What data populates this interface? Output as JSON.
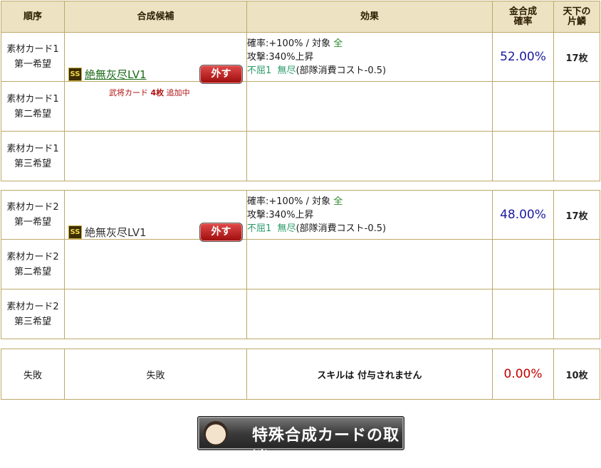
{
  "header": {
    "order": "順序",
    "candidate": "合成候補",
    "effect": "効果",
    "rate_line1": "金合成",
    "rate_line2": "確率",
    "scale_line1": "天下の",
    "scale_line2": "片鱗"
  },
  "groups": [
    {
      "rows": [
        {
          "label_line1": "素材カード1",
          "label_line2": "第一希望",
          "badge": "SS",
          "skill": "絶無灰尽LV1",
          "remove": "外す",
          "note_prefix": "武将カード ",
          "note_count": "4枚",
          "note_suffix": " 追加中",
          "effect_rate": "確率:+100%  /  対象",
          "effect_target": "全",
          "effect_attack": "攻撃:340%上昇",
          "effect_immortal": "不屈1",
          "effect_infinite": "無尽",
          "effect_cost": "(部隊消費コスト-0.5)",
          "probability": "52.00%",
          "count": "17枚"
        },
        {
          "label_line1": "素材カード1",
          "label_line2": "第二希望"
        },
        {
          "label_line1": "素材カード1",
          "label_line2": "第三希望"
        }
      ]
    },
    {
      "rows": [
        {
          "label_line1": "素材カード2",
          "label_line2": "第一希望",
          "badge": "SS",
          "skill": "絶無灰尽LV1",
          "remove": "外す",
          "effect_rate": "確率:+100%  /  対象",
          "effect_target": "全",
          "effect_attack": "攻撃:340%上昇",
          "effect_immortal": "不屈1",
          "effect_infinite": "無尽",
          "effect_cost": "(部隊消費コスト-0.5)",
          "probability": "48.00%",
          "count": "17枚"
        },
        {
          "label_line1": "素材カード2",
          "label_line2": "第二希望"
        },
        {
          "label_line1": "素材カード2",
          "label_line2": "第三希望"
        }
      ]
    }
  ],
  "failure": {
    "label": "失敗",
    "candidate": "失敗",
    "effect": "スキルは 付与されません",
    "probability": "0.00%",
    "count": "10枚"
  },
  "cancel_button": {
    "label": "特殊合成カードの取消",
    "icon": "character-portrait-icon"
  },
  "colors": {
    "header_bg": "#ede3c2",
    "border": "#bda86a",
    "prob_blue": "#1a1aa0",
    "prob_red": "#c00000",
    "remove_red": "#c01818"
  }
}
